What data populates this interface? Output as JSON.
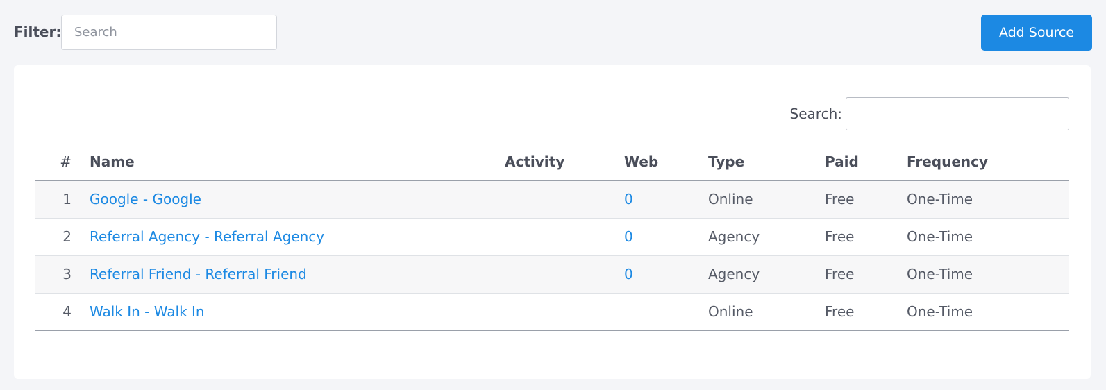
{
  "filter": {
    "label": "Filter:",
    "placeholder": "Search",
    "value": ""
  },
  "toolbar": {
    "add_label": "Add Source"
  },
  "search": {
    "label": "Search:",
    "value": ""
  },
  "table": {
    "headers": {
      "num": "#",
      "name": "Name",
      "activity": "Activity",
      "web": "Web",
      "type": "Type",
      "paid": "Paid",
      "frequency": "Frequency"
    },
    "rows": [
      {
        "num": "1",
        "name": "Google - Google",
        "activity": "",
        "web": "0",
        "type": "Online",
        "paid": "Free",
        "frequency": "One-Time"
      },
      {
        "num": "2",
        "name": "Referral Agency - Referral Agency",
        "activity": "",
        "web": "0",
        "type": "Agency",
        "paid": "Free",
        "frequency": "One-Time"
      },
      {
        "num": "3",
        "name": "Referral Friend - Referral Friend",
        "activity": "",
        "web": "0",
        "type": "Agency",
        "paid": "Free",
        "frequency": "One-Time"
      },
      {
        "num": "4",
        "name": "Walk In - Walk In",
        "activity": "",
        "web": "",
        "type": "Online",
        "paid": "Free",
        "frequency": "One-Time"
      }
    ]
  },
  "colors": {
    "accent": "#1c89e3",
    "background": "#f4f5f8",
    "card": "#ffffff",
    "text": "#4a4e5a"
  }
}
